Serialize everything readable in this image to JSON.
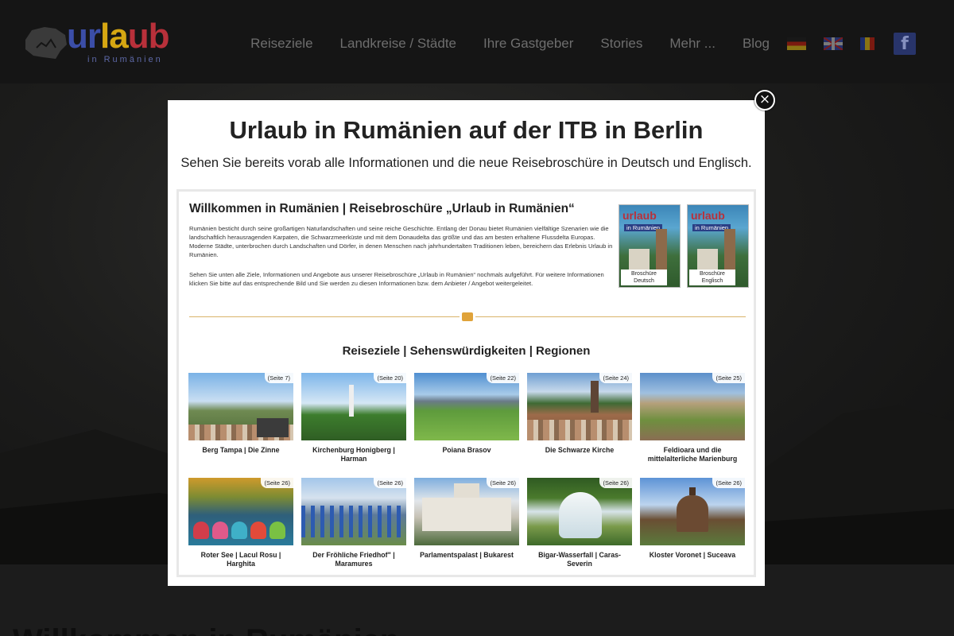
{
  "site": {
    "logo_text": [
      "ur",
      "la",
      "ub"
    ],
    "logo_subtitle": "in Rumänien"
  },
  "nav": {
    "items": [
      "Reiseziele",
      "Landkreise / Städte",
      "Ihre Gastgeber",
      "Stories",
      "Mehr ...",
      "Blog"
    ],
    "flags": [
      "flag-germany-icon",
      "flag-uk-icon",
      "flag-romania-icon"
    ],
    "social": "f"
  },
  "page": {
    "heading": "Willkommen in Rumänien"
  },
  "modal": {
    "close_symbol": "×",
    "title": "Urlaub in Rumänien auf der ITB in Berlin",
    "subtitle": "Sehen Sie bereits vorab alle Informationen und die neue Reisebroschüre in Deutsch und Englisch.",
    "brochure": {
      "title": "Willkommen in Rumänien | Reisebroschüre „Urlaub in Rumänien“",
      "paragraph1": "Rumänien besticht durch seine großartigen Naturlandschaften und seine reiche Geschichte. Entlang der Donau bietet Rumänien vielfältige Szenarien wie die landschaftlich herausragenden Karpaten, die Schwarzmeerküste und mit dem Donaudelta das größte und das am besten erhaltene Flussdelta Europas. Moderne Städte, unterbrochen durch Landschaften und Dörfer, in denen Menschen nach jahrhundertalten Traditionen leben, bereichern das Erlebnis Urlaub in Rumänien.",
      "paragraph2": "Sehen Sie unten alle Ziele, Informationen und Angebote aus unserer Reisebroschüre „Urlaub in Rumänien“ nochmals aufgeführt. Für weitere Informationen klicken Sie bitte auf das entsprechende Bild und Sie werden zu diesen Informationen bzw. dem Anbieter / Angebot weitergeleitet.",
      "covers": [
        {
          "logo": "urlaub",
          "sub": "in Rumänien",
          "label": "Broschüre Deutsch"
        },
        {
          "logo": "urlaub",
          "sub": "in Rumänien",
          "label": "Broschüre Englisch"
        }
      ],
      "section_title": "Reiseziele | Sehenswürdigkeiten | Regionen",
      "items": [
        {
          "page": "(Seite 7)",
          "caption": "Berg Tampa | Die Zinne"
        },
        {
          "page": "(Seite 20)",
          "caption": "Kirchenburg Honigberg | Harman"
        },
        {
          "page": "(Seite 22)",
          "caption": "Poiana Brasov"
        },
        {
          "page": "(Seite 24)",
          "caption": "Die Schwarze Kirche"
        },
        {
          "page": "(Seite 25)",
          "caption": "Feldioara und die mittelalterliche Marienburg"
        },
        {
          "page": "(Seite 26)",
          "caption": "Roter See | Lacul Rosu | Harghita"
        },
        {
          "page": "(Seite 26)",
          "caption": "Der Fröhliche Friedhof\" | Maramures"
        },
        {
          "page": "(Seite 26)",
          "caption": "Parlamentspalast | Bukarest"
        },
        {
          "page": "(Seite 26)",
          "caption": "Bigar-Wasserfall | Caras-Severin"
        },
        {
          "page": "(Seite 26)",
          "caption": "Kloster Voronet | Suceava"
        }
      ]
    }
  }
}
